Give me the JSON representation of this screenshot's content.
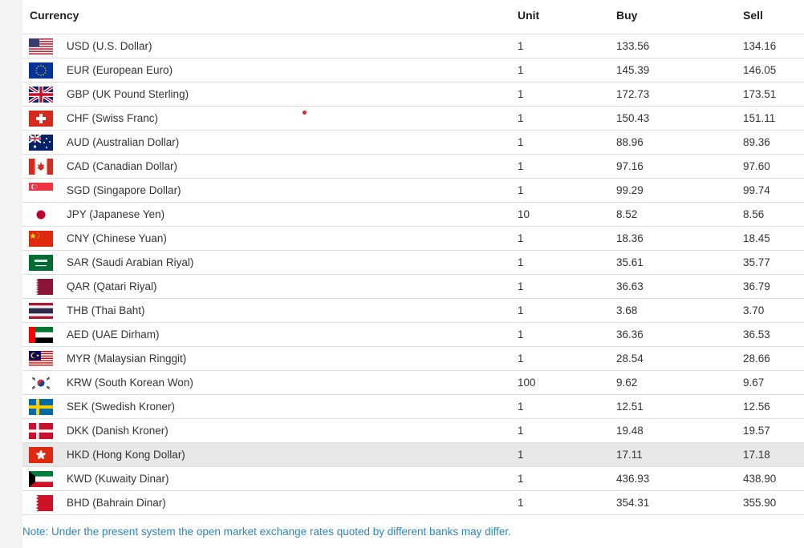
{
  "table": {
    "headers": {
      "currency": "Currency",
      "unit": "Unit",
      "buy": "Buy",
      "sell": "Sell"
    },
    "rows": [
      {
        "flag": "us-flag-icon",
        "currency": "USD (U.S. Dollar)",
        "unit": "1",
        "buy": "133.56",
        "sell": "134.16"
      },
      {
        "flag": "eu-flag-icon",
        "currency": "EUR (European Euro)",
        "unit": "1",
        "buy": "145.39",
        "sell": "146.05"
      },
      {
        "flag": "gb-flag-icon",
        "currency": "GBP (UK Pound Sterling)",
        "unit": "1",
        "buy": "172.73",
        "sell": "173.51"
      },
      {
        "flag": "ch-flag-icon",
        "currency": "CHF (Swiss Franc)",
        "unit": "1",
        "buy": "150.43",
        "sell": "151.11"
      },
      {
        "flag": "au-flag-icon",
        "currency": "AUD (Australian Dollar)",
        "unit": "1",
        "buy": "88.96",
        "sell": "89.36"
      },
      {
        "flag": "ca-flag-icon",
        "currency": "CAD (Canadian Dollar)",
        "unit": "1",
        "buy": "97.16",
        "sell": "97.60"
      },
      {
        "flag": "sg-flag-icon",
        "currency": "SGD (Singapore Dollar)",
        "unit": "1",
        "buy": "99.29",
        "sell": "99.74"
      },
      {
        "flag": "jp-flag-icon",
        "currency": "JPY (Japanese Yen)",
        "unit": "10",
        "buy": "8.52",
        "sell": "8.56"
      },
      {
        "flag": "cn-flag-icon",
        "currency": "CNY (Chinese Yuan)",
        "unit": "1",
        "buy": "18.36",
        "sell": "18.45"
      },
      {
        "flag": "sa-flag-icon",
        "currency": "SAR (Saudi Arabian Riyal)",
        "unit": "1",
        "buy": "35.61",
        "sell": "35.77"
      },
      {
        "flag": "qa-flag-icon",
        "currency": "QAR (Qatari Riyal)",
        "unit": "1",
        "buy": "36.63",
        "sell": "36.79"
      },
      {
        "flag": "th-flag-icon",
        "currency": "THB (Thai Baht)",
        "unit": "1",
        "buy": "3.68",
        "sell": "3.70"
      },
      {
        "flag": "ae-flag-icon",
        "currency": "AED (UAE Dirham)",
        "unit": "1",
        "buy": "36.36",
        "sell": "36.53"
      },
      {
        "flag": "my-flag-icon",
        "currency": "MYR (Malaysian Ringgit)",
        "unit": "1",
        "buy": "28.54",
        "sell": "28.66"
      },
      {
        "flag": "kr-flag-icon",
        "currency": "KRW (South Korean Won)",
        "unit": "100",
        "buy": "9.62",
        "sell": "9.67"
      },
      {
        "flag": "se-flag-icon",
        "currency": "SEK (Swedish Kroner)",
        "unit": "1",
        "buy": "12.51",
        "sell": "12.56"
      },
      {
        "flag": "dk-flag-icon",
        "currency": "DKK (Danish Kroner)",
        "unit": "1",
        "buy": "19.48",
        "sell": "19.57"
      },
      {
        "flag": "hk-flag-icon",
        "currency": "HKD (Hong Kong Dollar)",
        "unit": "1",
        "buy": "17.11",
        "sell": "17.18"
      },
      {
        "flag": "kw-flag-icon",
        "currency": "KWD (Kuwaity Dinar)",
        "unit": "1",
        "buy": "436.93",
        "sell": "438.90"
      },
      {
        "flag": "bh-flag-icon",
        "currency": "BHD (Bahrain Dinar)",
        "unit": "1",
        "buy": "354.31",
        "sell": "355.90"
      }
    ]
  },
  "note": "Note: Under the present system the open market exchange rates quoted by different banks may differ.",
  "colors": {
    "note": "#2e86c1",
    "highlight_row": "#e8e8e8",
    "divider": "#dddddd"
  }
}
